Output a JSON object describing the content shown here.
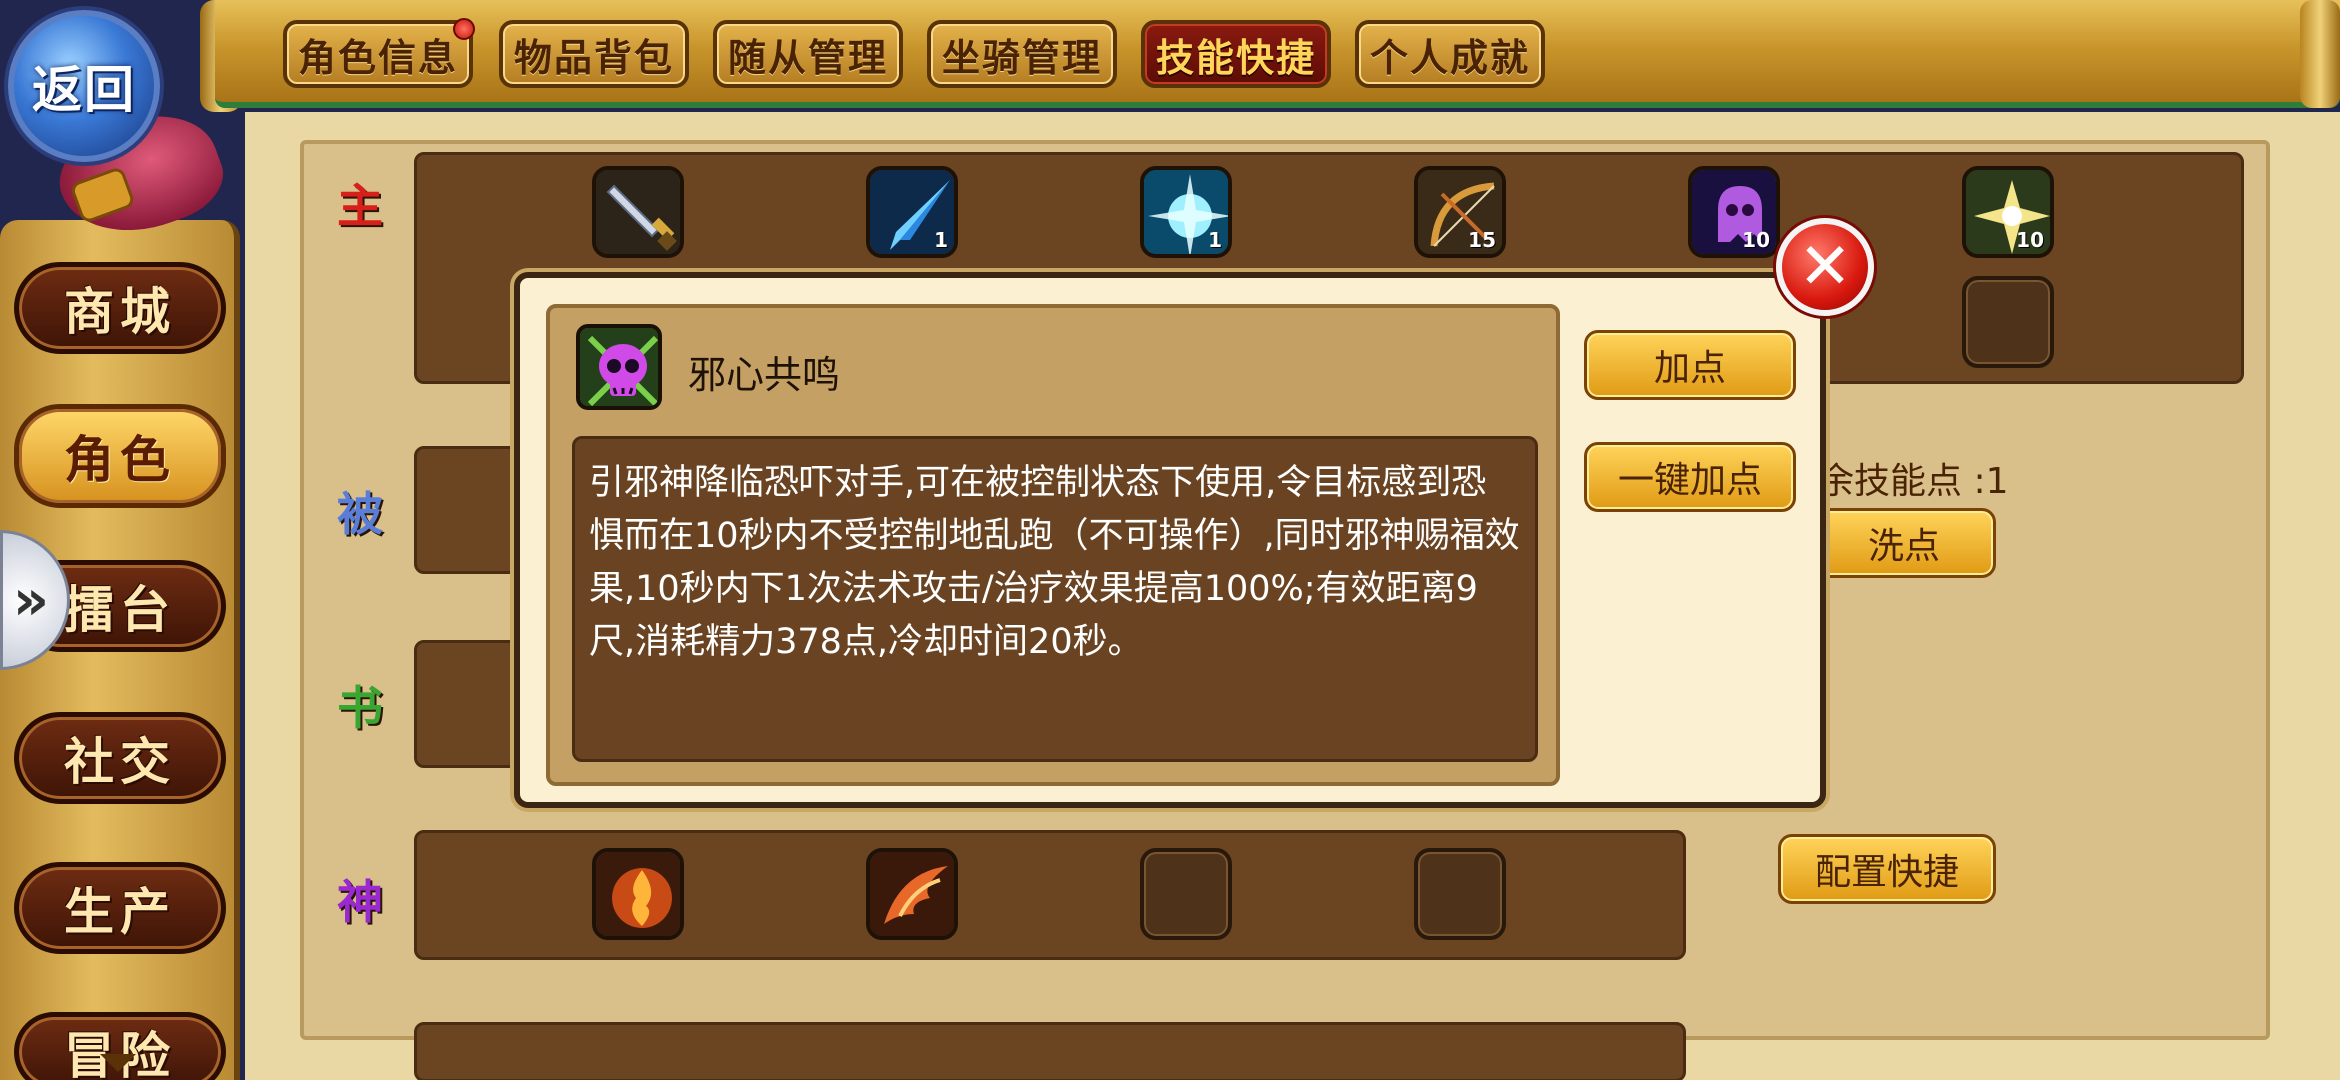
{
  "back_button": {
    "label": "返回"
  },
  "tabs": [
    {
      "label": "角色信息",
      "active": false,
      "notification": true
    },
    {
      "label": "物品背包",
      "active": false,
      "notification": false
    },
    {
      "label": "随从管理",
      "active": false,
      "notification": false
    },
    {
      "label": "坐骑管理",
      "active": false,
      "notification": false
    },
    {
      "label": "技能快捷",
      "active": true,
      "notification": false
    },
    {
      "label": "个人成就",
      "active": false,
      "notification": false
    }
  ],
  "sidebar": {
    "items": [
      {
        "label": "商城",
        "active": false
      },
      {
        "label": "角色",
        "active": true
      },
      {
        "label": "擂台",
        "active": false
      },
      {
        "label": "社交",
        "active": false
      },
      {
        "label": "生产",
        "active": false
      },
      {
        "label": "冒险",
        "active": false
      }
    ],
    "expand_glyph": "»"
  },
  "skill_rows": [
    {
      "label": "主",
      "color": "#d8201a"
    },
    {
      "label": "被",
      "color": "#5a7ed8"
    },
    {
      "label": "书",
      "color": "#3aa632"
    },
    {
      "label": "神",
      "color": "#9a2ad0"
    }
  ],
  "main_skills": [
    {
      "icon": "sword-icon",
      "level": ""
    },
    {
      "icon": "ice-spear-icon",
      "level": "1"
    },
    {
      "icon": "frost-burst-icon",
      "level": "1"
    },
    {
      "icon": "bow-icon",
      "level": "15"
    },
    {
      "icon": "ghost-icon",
      "level": "10"
    },
    {
      "icon": "star-flower-icon",
      "level": "10"
    }
  ],
  "god_skills": [
    {
      "icon": "flame-orb-icon",
      "filled": true
    },
    {
      "icon": "fire-wing-icon",
      "filled": true
    },
    {
      "icon": "empty-slot-icon",
      "filled": false
    },
    {
      "icon": "empty-slot-icon",
      "filled": false
    }
  ],
  "remaining_points": "余技能点 :1",
  "wash_button": "洗点",
  "config_button": "配置快捷",
  "popup": {
    "skill_name": "邪心共鸣",
    "skill_icon": "purple-skull-icon",
    "description": "引邪神降临恐吓对手,可在被控制状态下使用,令目标感到恐惧而在10秒内不受控制地乱跑（不可操作）,同时邪神赐福效果,10秒内下1次法术攻击/治疗效果提高100%;有效距离9尺,消耗精力378点,冷却时间20秒。",
    "add_point_button": "加点",
    "auto_add_button": "一键加点",
    "close_glyph": "✕"
  },
  "colors": {
    "accent_gold": "#e09a14",
    "panel_brown": "#6b4422",
    "active_tab": "#8a1a10"
  }
}
